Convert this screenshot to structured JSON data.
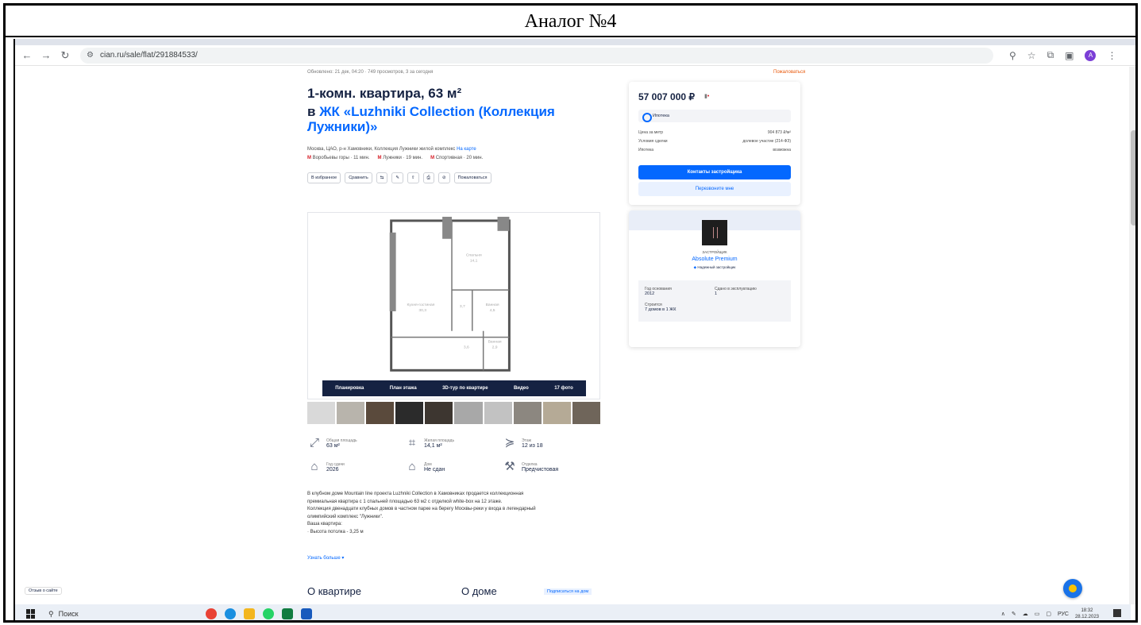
{
  "caption": "Аналог №4",
  "browser": {
    "url": "cian.ru/sale/flat/291884533/"
  },
  "listing": {
    "meta": "Обновлено: 21 дек, 04:20 · 749 просмотров, 3 за сегодня",
    "report": "Пожаловаться",
    "title": "1-комн. квартира, 63 м²",
    "subtitle_prefix": "в ",
    "subtitle_link": "ЖК «Luzhniki Collection (Коллекция Лужники)»",
    "address": "Москва, ЦАО, р-н Хамовники, Коллекция Лужники жилой комплекс",
    "map_link": "На карте",
    "metro": [
      {
        "name": "Воробьевы горы",
        "time": "11 мин."
      },
      {
        "name": "Лужники",
        "time": "19 мин."
      },
      {
        "name": "Спортивная",
        "time": "20 мин."
      }
    ],
    "actions": [
      "В избранное",
      "Сравнить",
      "⇆",
      "✎",
      "⇧",
      "⎙",
      "⊘",
      "Пожаловаться"
    ],
    "gallery_bar": [
      "Планировка",
      "План этажа",
      "3D-тур по квартире",
      "Видео",
      "17 фото"
    ],
    "facts": [
      {
        "label": "Общая площадь",
        "value": "63 м²"
      },
      {
        "label": "Жилая площадь",
        "value": "14,1 м²"
      },
      {
        "label": "Этаж",
        "value": "12 из 18"
      },
      {
        "label": "Год сдачи",
        "value": "2026"
      },
      {
        "label": "Дом",
        "value": "Не сдан"
      },
      {
        "label": "Отделка",
        "value": "Предчистовая"
      }
    ],
    "description": [
      "В клубном доме Mountain line проекта Luzhniki Collection в Хамовниках продается коллекционная",
      "премиальная квартира с 1 спальней площадью 63 м2 с отделкой white-box на 12 этаже.",
      "Коллекция двенадцати клубных домов в частном парке на берегу Москвы-реки у входа в легендарный",
      "олимпийский комплекс \"Лужники\".",
      "Ваша квартира:",
      "·     Высота потолка - 3,25 м"
    ],
    "more_link": "Узнать больше ▾",
    "section_flat": "О квартире",
    "section_house": "О доме",
    "section_tag": "Подписаться на дом",
    "feedback": "Отзыв о сайте"
  },
  "price_card": {
    "price": "57 007 000 ₽",
    "mortgage": "Ипотека",
    "rows": [
      {
        "label": "Цена за метр",
        "value": "904 873 ₽/м²"
      },
      {
        "label": "Условия сделки",
        "value": "долевое участие (214-ФЗ)"
      },
      {
        "label": "Ипотека",
        "value": "возможна"
      }
    ],
    "contact_button": "Контакты застройщика",
    "callback_button": "Перезвоните мне"
  },
  "developer": {
    "kind": "ЗАСТРОЙЩИК",
    "name": "Absolute Premium",
    "badge": "Надежный застройщик",
    "stats": [
      {
        "label": "Год основания",
        "value": "2012"
      },
      {
        "label": "Сдано в эксплуатацию",
        "value": "1"
      },
      {
        "label": "Строится",
        "value": "7 домов в 1 ЖК"
      }
    ]
  },
  "taskbar": {
    "search": "Поиск",
    "lang": "РУС",
    "time": "18:32",
    "date": "28.12.2023"
  },
  "colors": {
    "accent": "#0468ff",
    "text": "#152242",
    "metro": "#d7212a"
  }
}
